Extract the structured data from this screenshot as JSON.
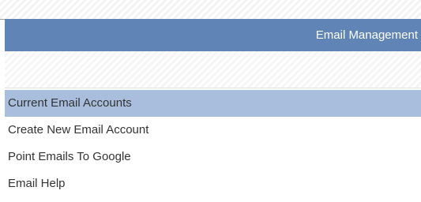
{
  "header": {
    "title": "Email Management"
  },
  "menu": {
    "items": [
      {
        "label": "Current Email Accounts",
        "active": true
      },
      {
        "label": "Create New Email Account",
        "active": false
      },
      {
        "label": "Point Emails To Google",
        "active": false
      },
      {
        "label": "Email Help",
        "active": false
      }
    ]
  },
  "colors": {
    "header_bg": "#5f84b5",
    "active_item_bg": "#a9bedd",
    "text": "#333333"
  }
}
